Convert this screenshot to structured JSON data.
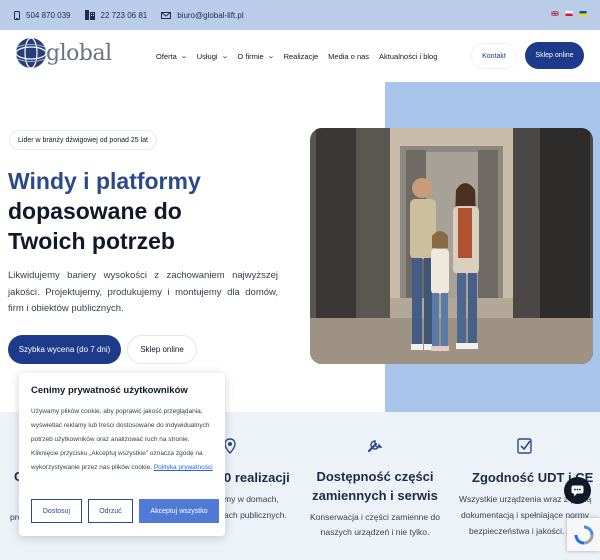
{
  "topbar": {
    "phone1": "504 870 039",
    "phone2": "22 723 06 81",
    "email": "biuro@global-lift.pl"
  },
  "header": {
    "logo_text": "global",
    "nav": [
      {
        "label": "Oferta",
        "dropdown": true
      },
      {
        "label": "Usługi",
        "dropdown": true
      },
      {
        "label": "O firmie",
        "dropdown": true
      },
      {
        "label": "Realizacje",
        "dropdown": false
      },
      {
        "label": "Media o nas",
        "dropdown": false
      },
      {
        "label": "Aktualności i blog",
        "dropdown": false
      }
    ],
    "contact_label": "Kontakt",
    "shop_label": "Sklep online"
  },
  "hero": {
    "badge": "Lider w branży dźwigowej od ponad 25 lat",
    "title_line1": "Windy i platformy",
    "title_line2": "dopasowane do",
    "title_line3": "Twoich potrzeb",
    "lead": "Likwidujemy bariery wysokości z zachowaniem najwyższej jakości. Projektujemy, produkujemy i montujemy dla domów, firm i obiektów publicznych.",
    "quote_button": "Szybka wycena (do 7 dni)",
    "shop_button": "Sklep online"
  },
  "features": [
    {
      "title_partial": "0 realizacji",
      "text_line1": "my w domach,",
      "text_line2": "ach publicznych."
    },
    {
      "title": "Dostępność części zamiennych i serwis",
      "text": "Konserwacja i części zamienne do naszych urządzeń i nie tylko."
    },
    {
      "title_partial": "Zgodność UDT i CE",
      "text_line1": "Wszystkie urządzenia wraz z pełną",
      "text_line2": "dokumentacją i spełniające normy",
      "text_line3": "bezpieczeństwa i jakości."
    }
  ],
  "features_left_fragments": {
    "c": "C",
    "pro": "pro"
  },
  "cookie": {
    "title": "Cenimy prywatność użytkowników",
    "text": "Używamy plików cookie, aby poprawić jakość przeglądania, wyświetlać reklamy lub treści dostosowane do indywidualnych potrzeb użytkowników oraz analizować ruch na stronie. Kliknięcie przycisku „Akceptuj wszystkie” oznacza zgodę na wykorzystywanie przez nas plików cookie.",
    "link": "Polityka prywatności",
    "btn_customize": "Dostosuj",
    "btn_reject": "Odrzuć",
    "btn_accept": "Akceptuj wszystko"
  },
  "colors": {
    "primary": "#1e3a8a",
    "accent": "#2c4a8a",
    "topbar": "#b9cde9"
  }
}
